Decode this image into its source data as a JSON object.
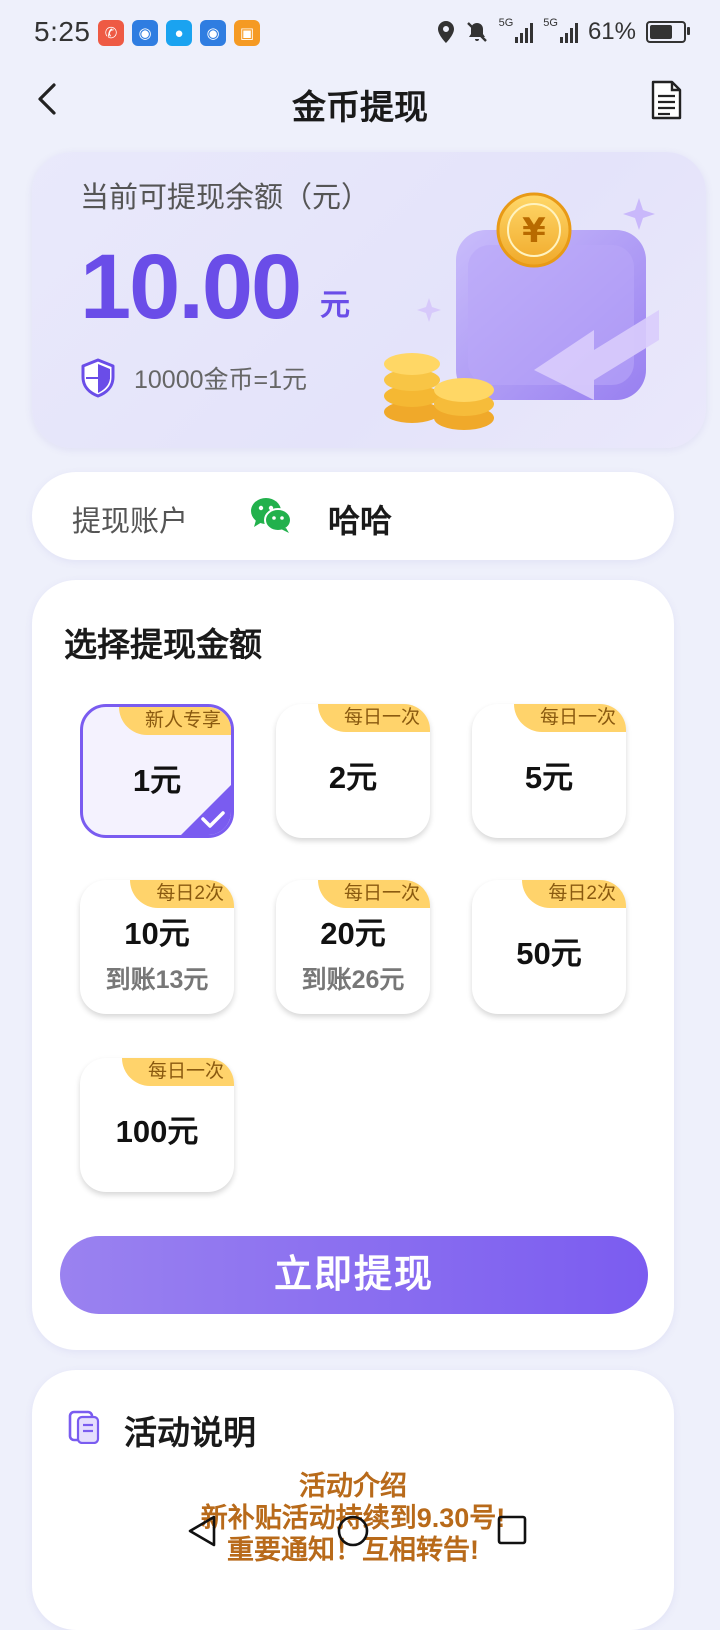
{
  "status_bar": {
    "time": "5:25",
    "signal1": "5G",
    "signal2": "5G",
    "battery": "61%",
    "battery_level": 0.61
  },
  "header": {
    "title": "金币提现"
  },
  "balance": {
    "label": "当前可提现余额（元）",
    "amount": "10.00",
    "unit": "元",
    "rate": "10000金币=1元"
  },
  "account": {
    "label": "提现账户",
    "name": "哈哈"
  },
  "select": {
    "title": "选择提现金额",
    "options": [
      {
        "amount": "1元",
        "tag": "新人专享",
        "sub": "",
        "selected": true
      },
      {
        "amount": "2元",
        "tag": "每日一次",
        "sub": ""
      },
      {
        "amount": "5元",
        "tag": "每日一次",
        "sub": ""
      },
      {
        "amount": "10元",
        "tag": "每日2次",
        "sub": "到账13元"
      },
      {
        "amount": "20元",
        "tag": "每日一次",
        "sub": "到账26元"
      },
      {
        "amount": "50元",
        "tag": "每日2次",
        "sub": ""
      },
      {
        "amount": "100元",
        "tag": "每日一次",
        "sub": ""
      }
    ],
    "button": "立即提现"
  },
  "activity": {
    "title": "活动说明",
    "lines": [
      "活动介绍",
      "新补贴活动持续到9.30号!",
      "重要通知！互相转告!"
    ]
  },
  "colors": {
    "accent": "#6a4de8",
    "tag": "#ffd36b",
    "notice": "#b86a1a",
    "wechat": "#22b14c"
  }
}
